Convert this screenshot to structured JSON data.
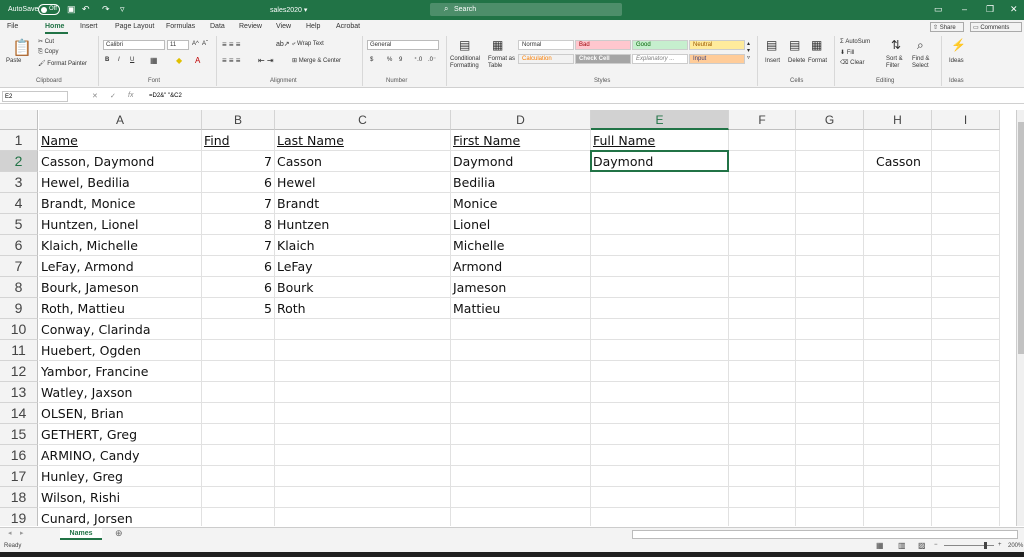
{
  "titlebar": {
    "autosave_label": "AutoSave",
    "autosave_state": "Off",
    "filename": "sales2020",
    "filename_chevron": "▾",
    "search_placeholder": "Search",
    "icons": [
      "save-icon",
      "undo-icon",
      "redo-icon",
      "customize-qat-icon"
    ]
  },
  "tabs": [
    "File",
    "Home",
    "Insert",
    "Page Layout",
    "Formulas",
    "Data",
    "Review",
    "View",
    "Help",
    "Acrobat"
  ],
  "share_label": "Share",
  "comments_label": "Comments",
  "ribbon": {
    "clipboard": {
      "paste": "Paste",
      "cut": "Cut",
      "copy": "Copy",
      "format_painter": "Format Painter",
      "group": "Clipboard"
    },
    "font": {
      "name": "Calibri",
      "size": "11",
      "group": "Font",
      "bold": "B",
      "italic": "I",
      "underline": "U",
      "grow": "A^",
      "shrink": "Aˇ"
    },
    "alignment": {
      "wrap": "Wrap Text",
      "merge": "Merge & Center",
      "group": "Alignment"
    },
    "number": {
      "format": "General",
      "currency": "$",
      "percent": "%",
      "comma": "9",
      "group": "Number"
    },
    "styles": {
      "conditional": "Conditional Formatting",
      "format_as_table": "Format as Table",
      "normal": "Normal",
      "bad": "Bad",
      "good": "Good",
      "neutral": "Neutral",
      "calculation": "Calculation",
      "check_cell": "Check Cell",
      "explanatory": "Explanatory ...",
      "input": "Input",
      "group": "Styles"
    },
    "cells": {
      "insert": "Insert",
      "delete": "Delete",
      "format": "Format",
      "group": "Cells"
    },
    "editing": {
      "autosum": "AutoSum",
      "fill": "Fill",
      "clear": "Clear",
      "sort": "Sort & Filter",
      "find": "Find & Select",
      "group": "Editing"
    },
    "ideas": {
      "label": "Ideas",
      "group": "Ideas"
    }
  },
  "formula_bar": {
    "name_box": "E2",
    "cancel": "✕",
    "enter": "✓",
    "fx": "fx",
    "formula": "=D2&\" \"&C2"
  },
  "columns": [
    "A",
    "B",
    "C",
    "D",
    "E",
    "F",
    "G",
    "H",
    "I"
  ],
  "selected_column": "E",
  "selected_row": 2,
  "headers": {
    "A": "Name",
    "B": "Find",
    "C": "Last Name",
    "D": "First Name",
    "E": "Full Name"
  },
  "rows": [
    {
      "n": 1
    },
    {
      "n": 2,
      "A": "Casson, Daymond",
      "B": "7",
      "C": "Casson",
      "D": "Daymond",
      "E": "Daymond",
      "H": "Casson"
    },
    {
      "n": 3,
      "A": "Hewel, Bedilia",
      "B": "6",
      "C": "Hewel",
      "D": "Bedilia"
    },
    {
      "n": 4,
      "A": "Brandt, Monice",
      "B": "7",
      "C": "Brandt",
      "D": "Monice"
    },
    {
      "n": 5,
      "A": "Huntzen, Lionel",
      "B": "8",
      "C": "Huntzen",
      "D": "Lionel"
    },
    {
      "n": 6,
      "A": "Klaich, Michelle",
      "B": "7",
      "C": "Klaich",
      "D": "Michelle"
    },
    {
      "n": 7,
      "A": "LeFay, Armond",
      "B": "6",
      "C": "LeFay",
      "D": "Armond"
    },
    {
      "n": 8,
      "A": "Bourk, Jameson",
      "B": "6",
      "C": "Bourk",
      "D": "Jameson"
    },
    {
      "n": 9,
      "A": "Roth, Mattieu",
      "B": "5",
      "C": "Roth",
      "D": "Mattieu"
    },
    {
      "n": 10,
      "A": "Conway, Clarinda"
    },
    {
      "n": 11,
      "A": "Huebert, Ogden"
    },
    {
      "n": 12,
      "A": "Yambor, Francine"
    },
    {
      "n": 13,
      "A": "Watley, Jaxson"
    },
    {
      "n": 14,
      "A": "OLSEN, Brian"
    },
    {
      "n": 15,
      "A": "GETHERT, Greg"
    },
    {
      "n": 16,
      "A": "ARMINO, Candy"
    },
    {
      "n": 17,
      "A": "Hunley, Greg"
    },
    {
      "n": 18,
      "A": "Wilson, Rishi"
    },
    {
      "n": 19,
      "A": "Cunard, Jorsen"
    }
  ],
  "sheet_tab": "Names",
  "add_sheet": "⊕",
  "status": {
    "ready": "Ready",
    "zoom": "200%"
  },
  "colors": {
    "accent": "#217346",
    "bad_bg": "#ffc7ce",
    "good_bg": "#c6efce",
    "neutral_bg": "#ffeb9c",
    "calc_bg": "#f2f2f2",
    "check_bg": "#a5a5a5",
    "input_bg": "#ffcc99"
  }
}
